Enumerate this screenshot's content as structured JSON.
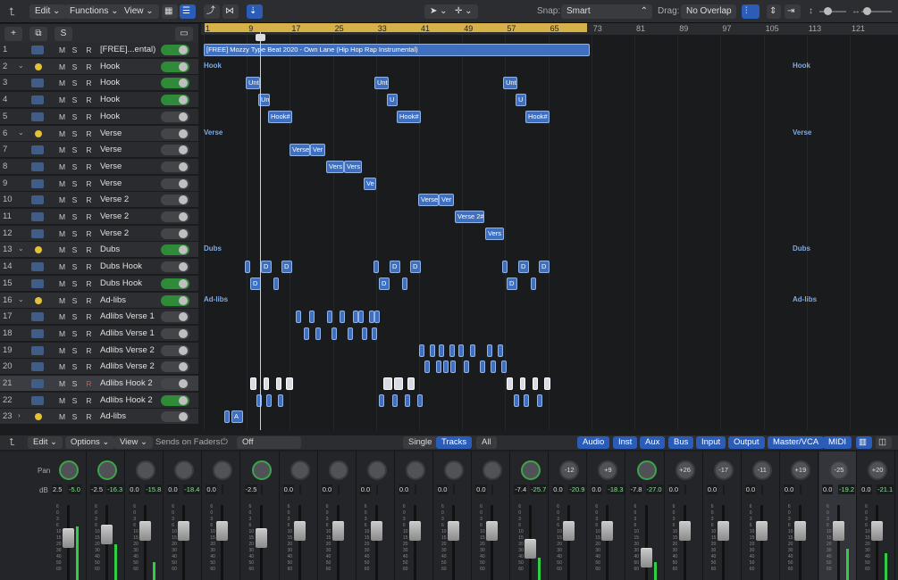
{
  "toolbar": {
    "edit": "Edit",
    "functions": "Functions",
    "view": "View",
    "snap_label": "Snap:",
    "snap_value": "Smart",
    "drag_label": "Drag:",
    "drag_value": "No Overlap"
  },
  "ruler": [
    "1",
    "9",
    "17",
    "25",
    "33",
    "41",
    "49",
    "57",
    "65",
    "73",
    "81",
    "89",
    "97",
    "105",
    "113",
    "121"
  ],
  "tracks": [
    {
      "num": "1",
      "name": "[FREE]...ental)",
      "type": "audio",
      "on": true
    },
    {
      "num": "2",
      "name": "Hook",
      "type": "folder",
      "on": true
    },
    {
      "num": "3",
      "name": "Hook",
      "type": "audio",
      "on": true
    },
    {
      "num": "4",
      "name": "Hook",
      "type": "audio",
      "on": true
    },
    {
      "num": "5",
      "name": "Hook",
      "type": "audio",
      "on": false
    },
    {
      "num": "6",
      "name": "Verse",
      "type": "folder",
      "on": false
    },
    {
      "num": "7",
      "name": "Verse",
      "type": "audio",
      "on": false
    },
    {
      "num": "8",
      "name": "Verse",
      "type": "audio",
      "on": false
    },
    {
      "num": "9",
      "name": "Verse",
      "type": "audio",
      "on": false
    },
    {
      "num": "10",
      "name": "Verse 2",
      "type": "audio",
      "on": false
    },
    {
      "num": "11",
      "name": "Verse 2",
      "type": "audio",
      "on": false
    },
    {
      "num": "12",
      "name": "Verse 2",
      "type": "audio",
      "on": false
    },
    {
      "num": "13",
      "name": "Dubs",
      "type": "folder",
      "on": true
    },
    {
      "num": "14",
      "name": "Dubs Hook",
      "type": "audio",
      "on": false
    },
    {
      "num": "15",
      "name": "Dubs Hook",
      "type": "audio",
      "on": true
    },
    {
      "num": "16",
      "name": "Ad-libs",
      "type": "folder",
      "on": true
    },
    {
      "num": "17",
      "name": "Adlibs Verse 1",
      "type": "audio",
      "on": false
    },
    {
      "num": "18",
      "name": "Adlibs Verse 1",
      "type": "audio",
      "on": false
    },
    {
      "num": "19",
      "name": "Adlibs Verse 2",
      "type": "audio",
      "on": false
    },
    {
      "num": "20",
      "name": "Adlibs Verse 2",
      "type": "audio",
      "on": false
    },
    {
      "num": "21",
      "name": "Adlibs Hook 2",
      "type": "audio",
      "on": false
    },
    {
      "num": "22",
      "name": "Adlibs Hook 2",
      "type": "audio",
      "on": true
    },
    {
      "num": "23",
      "name": "Ad-libs",
      "type": "folder",
      "on": false
    }
  ],
  "msr": {
    "m": "M",
    "s": "S",
    "r": "R"
  },
  "regions": {
    "main": "[FREE] Mozzy Type Beat 2020 - Own Lane (Hip Hop Rap Instrumental)",
    "unt": "Unt",
    "u": "U",
    "un": "Un",
    "hook": "Hook#",
    "verse": "Verse",
    "ver": "Ver",
    "vers": "Vers",
    "ve": "Ve",
    "verse2": "Verse 2#",
    "d": "D",
    "a": "A"
  },
  "sections": {
    "hook": "Hook",
    "verse": "Verse",
    "dubs": "Dubs",
    "adlibs": "Ad-libs"
  },
  "mixer_toolbar": {
    "edit": "Edit",
    "options": "Options",
    "view": "View",
    "sends_label": "Sends on Faders:",
    "sends_value": "Off",
    "single": "Single",
    "tracks": "Tracks",
    "all": "All",
    "audio": "Audio",
    "inst": "Inst",
    "aux": "Aux",
    "bus": "Bus",
    "input": "Input",
    "output": "Output",
    "master": "Master/VCA",
    "midi": "MIDI"
  },
  "mixer": {
    "pan_label": "Pan",
    "db_label": "dB",
    "strips": [
      {
        "pan": "",
        "g": true,
        "v": "2.5",
        "p": "-5.0"
      },
      {
        "pan": "",
        "g": true,
        "v": "-2.5",
        "p": "-16.3"
      },
      {
        "pan": "",
        "g": false,
        "v": "0.0",
        "p": "-15.8"
      },
      {
        "pan": "",
        "g": false,
        "v": "0.0",
        "p": "-18.4"
      },
      {
        "pan": "",
        "g": false,
        "v": "0.0",
        "p": ""
      },
      {
        "pan": "",
        "g": true,
        "v": "-2.5",
        "p": ""
      },
      {
        "pan": "",
        "g": false,
        "v": "0.0",
        "p": ""
      },
      {
        "pan": "",
        "g": false,
        "v": "0.0",
        "p": ""
      },
      {
        "pan": "",
        "g": false,
        "v": "0.0",
        "p": ""
      },
      {
        "pan": "",
        "g": false,
        "v": "0.0",
        "p": ""
      },
      {
        "pan": "",
        "g": false,
        "v": "0.0",
        "p": ""
      },
      {
        "pan": "",
        "g": false,
        "v": "0.0",
        "p": ""
      },
      {
        "pan": "",
        "g": true,
        "v": "-7.4",
        "p": "-25.7"
      },
      {
        "pan": "-12",
        "g": false,
        "v": "0.0",
        "p": "-20.9"
      },
      {
        "pan": "+9",
        "g": false,
        "v": "0.0",
        "p": "-18.3"
      },
      {
        "pan": "",
        "g": true,
        "v": "-7.8",
        "p": "-27.0"
      },
      {
        "pan": "+26",
        "g": false,
        "v": "0.0",
        "p": ""
      },
      {
        "pan": "-17",
        "g": false,
        "v": "0.0",
        "p": ""
      },
      {
        "pan": "-11",
        "g": false,
        "v": "0.0",
        "p": ""
      },
      {
        "pan": "+19",
        "g": false,
        "v": "0.0",
        "p": ""
      },
      {
        "pan": "-25",
        "g": false,
        "v": "0.0",
        "p": "-19.2"
      },
      {
        "pan": "+20",
        "g": false,
        "v": "0.0",
        "p": "-21.1"
      },
      {
        "pan": "",
        "g": false,
        "v": "",
        "p": ""
      }
    ],
    "scale": [
      "6",
      "0",
      "3",
      "6",
      "10",
      "15",
      "20",
      "30",
      "40",
      "50",
      "60"
    ]
  }
}
